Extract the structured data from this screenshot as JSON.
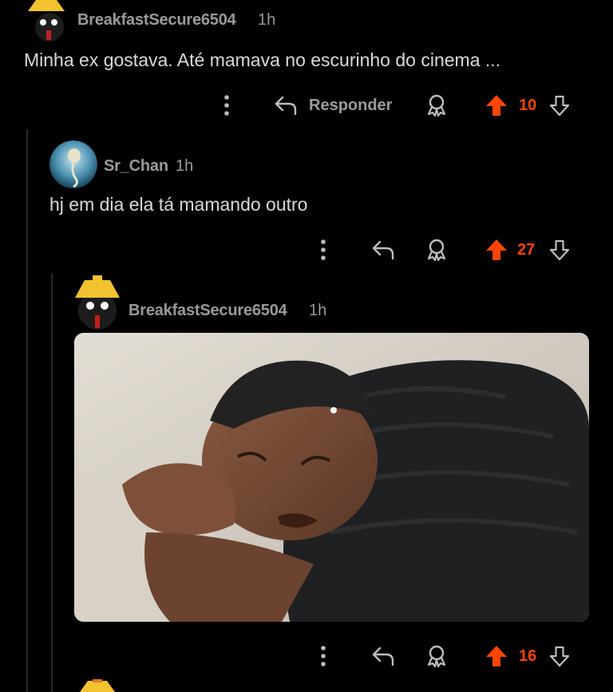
{
  "comments": [
    {
      "username": "BreakfastSecure6504",
      "time": "1h",
      "body": "Minha ex gostava. Até mamava no escurinho do cinema ...",
      "reply_label": "Responder",
      "votes": "10",
      "avatar": "hooded-mascot-avatar"
    },
    {
      "username": "Sr_Chan",
      "time": "1h",
      "body": "hj em dia ela tá mamando outro",
      "votes": "27",
      "avatar": "round-blue-avatar"
    },
    {
      "username": "BreakfastSecure6504",
      "time": "1h",
      "image": "crying-man-on-couch",
      "votes": "16",
      "avatar": "hooded-mascot-avatar"
    }
  ],
  "icons": {
    "more": "more-vertical-icon",
    "reply": "reply-arrow-icon",
    "award": "award-icon",
    "upvote": "upvote-arrow-icon",
    "downvote": "downvote-arrow-icon"
  },
  "colors": {
    "background": "#000000",
    "text": "#d7dadc",
    "muted": "#9a9a9a",
    "upvote": "#ff4500"
  }
}
